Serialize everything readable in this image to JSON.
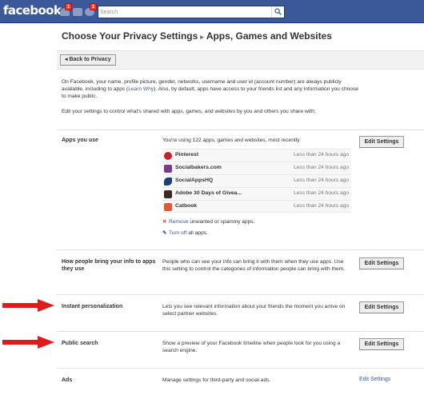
{
  "header": {
    "logo": "facebook",
    "jewels": [
      {
        "icon": "friend-requests-icon",
        "badge": "1"
      },
      {
        "icon": "messages-icon",
        "badge": ""
      },
      {
        "icon": "notifications-icon",
        "badge": "1"
      }
    ],
    "search_placeholder": "Search"
  },
  "page": {
    "title": "Choose Your Privacy Settings",
    "separator": "▸",
    "subtitle": "Apps, Games and Websites",
    "back_button": "◂ Back to Privacy"
  },
  "intro": {
    "paragraph1_before_link": "On Facebook, your name, profile picture, gender, networks, username and user id (account number) are always publicly available, including to apps (",
    "learn_why": "Learn Why",
    "paragraph1_after_link": "). Also, by default, apps have access to your friends list and any information you choose to make public.",
    "paragraph2": "Edit your settings to control what's shared with apps, games, and websites by you and others you share with:"
  },
  "sections": {
    "apps_you_use": {
      "label": "Apps you use",
      "description": "You're using 122 apps, games and websites, most recently:",
      "button": "Edit Settings",
      "apps": [
        {
          "name": "Pinterest",
          "time": "Less than 24 hours ago",
          "color": "#cb2027"
        },
        {
          "name": "Socialbakers.com",
          "time": "Less than 24 hours ago",
          "color": "#7a3b8f"
        },
        {
          "name": "SocialAppsHQ",
          "time": "Less than 24 hours ago",
          "color": "#1c3f7a"
        },
        {
          "name": "Adobe 30 Days of Givea...",
          "time": "Less than 24 hours ago",
          "color": "#3a2a1e"
        },
        {
          "name": "Catbook",
          "time": "Less than 24 hours ago",
          "color": "#e4572e"
        }
      ],
      "remove_link": "Remove",
      "remove_text": " unwanted or spammy apps.",
      "turn_off_link": "Turn off",
      "turn_off_text": " all apps."
    },
    "bring_info": {
      "label": "How people bring your info to apps they use",
      "description": "People who can see your info can bring it with them when they use apps. Use this setting to control the categories of information people can bring with them.",
      "button": "Edit Settings"
    },
    "instant_personalization": {
      "label": "Instant personalization",
      "description": "Lets you see relevant information about your friends the moment you arrive on select partner websites.",
      "button": "Edit Settings"
    },
    "public_search": {
      "label": "Public search",
      "description": "Show a preview of your Facebook timeline when people look for you using a search engine.",
      "button": "Edit Settings"
    },
    "ads": {
      "label": "Ads",
      "description": "Manage settings for third-party and social ads.",
      "link": "Edit Settings"
    }
  },
  "colors": {
    "brand": "#3b5998",
    "arrow": "#e01b1b",
    "badge": "#f03d25"
  }
}
